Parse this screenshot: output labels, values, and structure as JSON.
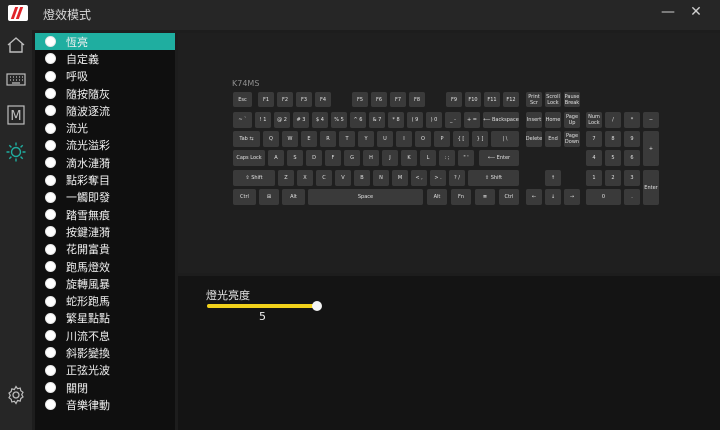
{
  "window": {
    "title": "燈效模式",
    "minimize_glyph": "—",
    "close_glyph": "✕"
  },
  "rail": {
    "icons": [
      "home-icon",
      "keyboard-icon",
      "macro-m-icon",
      "lighting-sun-icon",
      "settings-gear-icon"
    ],
    "active_icon": "lighting-sun-icon",
    "macro_letter": "M"
  },
  "modes": {
    "selected": "恆亮",
    "items": [
      "恆亮",
      "自定義",
      "呼吸",
      "隨按隨灰",
      "隨波逐流",
      "流光",
      "流光溢彩",
      "滴水漣漪",
      "點彩奪目",
      "一觸即發",
      "踏雪無痕",
      "按鍵漣漪",
      "花開富貴",
      "跑馬燈效",
      "旋轉風暴",
      "蛇形跑馬",
      "繁星點點",
      "川流不息",
      "斜影變換",
      "正弦光波",
      "關閉",
      "音樂律動"
    ]
  },
  "keyboard": {
    "model": "K74MS",
    "keys": [
      "Esc",
      "F1",
      "F2",
      "F3",
      "F4",
      "F5",
      "F6",
      "F7",
      "F8",
      "F9",
      "F10",
      "F11",
      "F12",
      "Print Scr",
      "Scroll Lock",
      "Pause Break",
      "~ `",
      "! 1",
      "@ 2",
      "# 3",
      "$ 4",
      "% 5",
      "^ 6",
      "& 7",
      "* 8",
      "( 9",
      ") 0",
      "_ -",
      "+ =",
      "⟵ Backspace",
      "Insert",
      "Home",
      "Page Up",
      "Num Lock",
      "/",
      "*",
      "−",
      "Tab ⇆",
      "Q",
      "W",
      "E",
      "R",
      "T",
      "Y",
      "U",
      "I",
      "O",
      "P",
      "{ [",
      "} ]",
      "| \\",
      "Delete",
      "End",
      "Page Down",
      "7",
      "8",
      "9",
      "+",
      "Caps Lock",
      "A",
      "S",
      "D",
      "F",
      "G",
      "H",
      "J",
      "K",
      "L",
      ": ;",
      "\" '",
      "⟵ Enter",
      "4",
      "5",
      "6",
      "⇧ Shift",
      "Z",
      "X",
      "C",
      "V",
      "B",
      "N",
      "M",
      "< ,",
      "> .",
      "? /",
      "⇧ Shift",
      "↑",
      "1",
      "2",
      "3",
      "Enter",
      "Ctrl",
      "⊞",
      "Alt",
      "Space",
      "Alt",
      "Fn",
      "≣",
      "Ctrl",
      "←",
      "↓",
      "→",
      "0",
      "."
    ]
  },
  "brightness": {
    "label": "燈光亮度",
    "value": "5",
    "level_fraction": 1.0
  },
  "colors": {
    "accent": "#1faea0",
    "slider": "#f2d21b"
  }
}
